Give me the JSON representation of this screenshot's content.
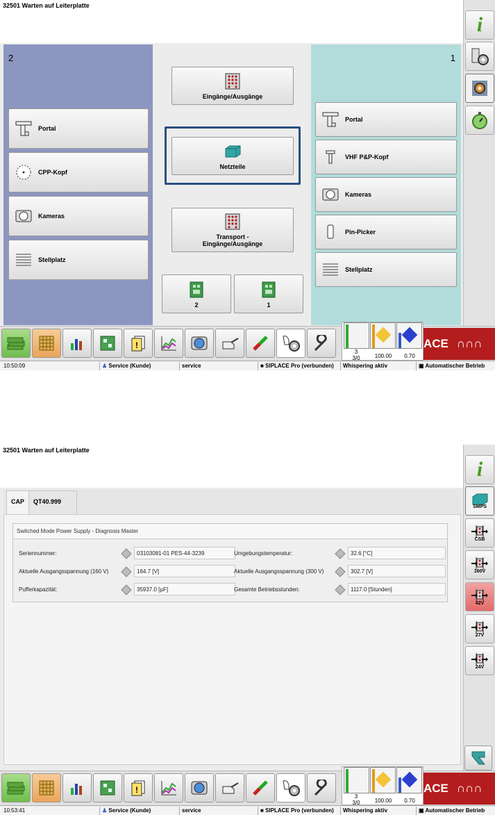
{
  "screen1": {
    "title": "32501 Warten auf Leiterplatte",
    "left_panel": {
      "number": "2",
      "buttons": [
        "Portal",
        "CPP-Kopf",
        "Kameras",
        "Stellplatz"
      ]
    },
    "right_panel": {
      "number": "1",
      "buttons": [
        "Portal",
        "VHF P&P-Kopf",
        "Kameras",
        "Pin-Picker",
        "Stellplatz"
      ]
    },
    "middle": {
      "io": "Eingänge/Ausgänge",
      "power": "Netzteile",
      "transport": "Transport -\nEingänge/Ausgänge",
      "conv2": "2",
      "conv1": "1"
    },
    "status": {
      "time": "10:50:09",
      "user": "Service (Kunde)",
      "role": "service",
      "siplace": "SIPLACE Pro (verbunden)",
      "whisper": "Whispering aktiv",
      "mode": "Automatischer Betrieb"
    }
  },
  "screen2": {
    "title": "32501 Warten auf Leiterplatte",
    "tabs": [
      "CAP",
      "QT40.999"
    ],
    "group_title": "Switched Mode Power Supply - Diagnosis Master",
    "fields": [
      {
        "label": "Seriennummer:",
        "value": "03103081-01 PES-44-3239"
      },
      {
        "label": "Umgebungstemperatur:",
        "value": "32.6 [°C]"
      },
      {
        "label": "Aktuelle Ausgangsspannung (160 V)",
        "value": "164.7 [V]"
      },
      {
        "label": "Aktuelle Ausgangsspannung (300 V)",
        "value": "302.7 [V]"
      },
      {
        "label": "Pufferkapazität:",
        "value": "35937.0 [µF]"
      },
      {
        "label": "Gesamte Betriebsstunden:",
        "value": "1117.0 [Stunden]"
      }
    ],
    "side_buttons": [
      "SMPS",
      "CSB",
      "160V",
      "42V",
      "27V",
      "24V"
    ],
    "status": {
      "time": "10:53:41",
      "user": "Service (Kunde)",
      "role": "service",
      "siplace": "SIPLACE Pro (verbunden)",
      "whisper": "Whispering aktiv",
      "mode": "Automatischer Betrieb"
    }
  },
  "gauges": {
    "left_bottom": "3",
    "left_sub": "3/0",
    "mid_value": "100.00",
    "right_value": "0.70",
    "mid_ticks": [
      "100",
      "99.6",
      "99.2",
      "98.8",
      "98.4",
      "98.0"
    ],
    "right_ticks": [
      "1.6",
      "1.4",
      "1.2",
      "1.0",
      "0.8",
      "0.6"
    ],
    "left_ticks": [
      "100",
      "80",
      "60",
      "40",
      "20",
      "0"
    ]
  },
  "brand": {
    "text": "ACE",
    "tail": "∩∩∩"
  },
  "info_glyph": "i",
  "colors": {
    "left_panel": "#8c96c0",
    "right_panel": "#b1dcdb",
    "brand": "#b41d1d",
    "focus": "#2b4f82",
    "warn_button": "#e36b6b"
  }
}
